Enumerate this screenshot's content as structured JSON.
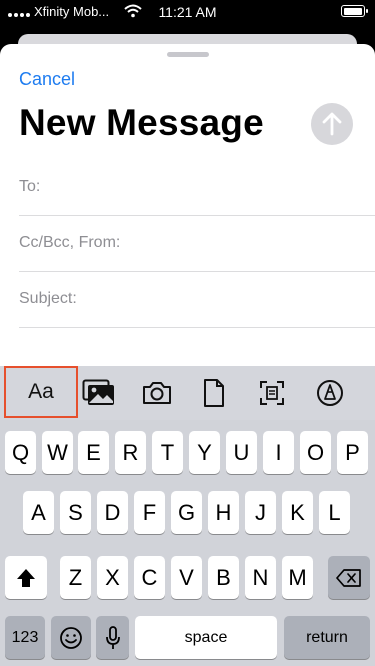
{
  "status_bar": {
    "carrier": "Xfinity Mob...",
    "time": "11:21 AM"
  },
  "compose": {
    "cancel_label": "Cancel",
    "title": "New Message",
    "fields": {
      "to": "To:",
      "cc": "Cc/Bcc, From:",
      "subject": "Subject:"
    }
  },
  "format_bar": {
    "text_format_label": "Aa",
    "icons": [
      "photo-library-icon",
      "camera-icon",
      "document-icon",
      "scan-document-icon",
      "markup-icon"
    ],
    "highlight_color": "#e6502d"
  },
  "keyboard": {
    "row1": [
      "Q",
      "W",
      "E",
      "R",
      "T",
      "Y",
      "U",
      "I",
      "O",
      "P"
    ],
    "row2": [
      "A",
      "S",
      "D",
      "F",
      "G",
      "H",
      "J",
      "K",
      "L"
    ],
    "row3": [
      "Z",
      "X",
      "C",
      "V",
      "B",
      "N",
      "M"
    ],
    "numbers_label": "123",
    "space_label": "space",
    "return_label": "return"
  },
  "colors": {
    "accent": "#1e7cf0",
    "send_disabled": "#d7d7db"
  }
}
